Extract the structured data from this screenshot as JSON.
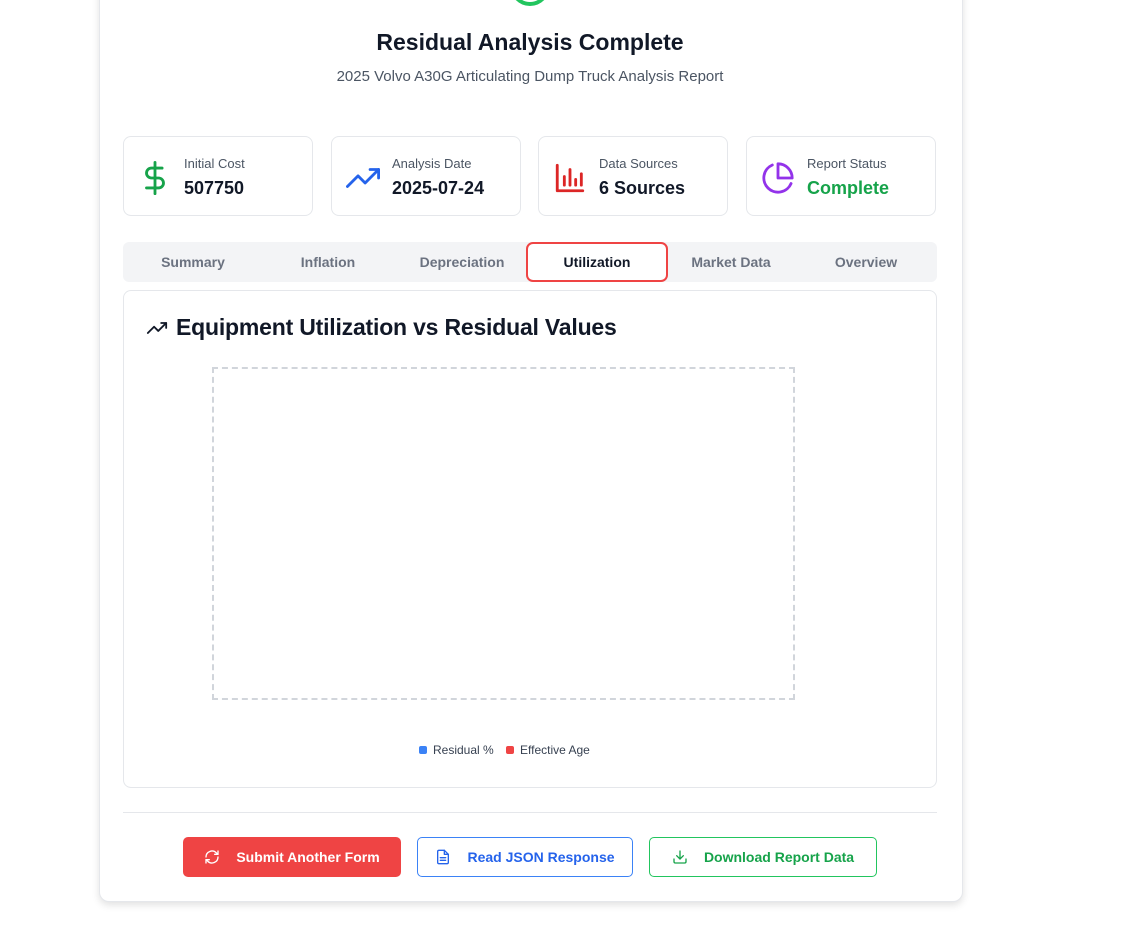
{
  "header": {
    "title": "Residual Analysis Complete",
    "subtitle": "2025 Volvo A30G Articulating Dump Truck Analysis Report"
  },
  "stats": [
    {
      "label": "Initial Cost",
      "value": "507750",
      "icon": "dollar-icon",
      "color": "#16a34a"
    },
    {
      "label": "Analysis Date",
      "value": "2025-07-24",
      "icon": "trending-up-icon",
      "color": "#2563eb"
    },
    {
      "label": "Data Sources",
      "value": "6 Sources",
      "icon": "bar-chart-icon",
      "color": "#dc2626"
    },
    {
      "label": "Report Status",
      "value": "Complete",
      "icon": "pie-chart-icon",
      "color": "#9333ea"
    }
  ],
  "tabs": [
    {
      "label": "Summary",
      "active": false
    },
    {
      "label": "Inflation",
      "active": false
    },
    {
      "label": "Depreciation",
      "active": false
    },
    {
      "label": "Utilization",
      "active": true
    },
    {
      "label": "Market Data",
      "active": false
    },
    {
      "label": "Overview",
      "active": false
    }
  ],
  "panel": {
    "title": "Equipment Utilization vs Residual Values",
    "legend": [
      {
        "label": "Residual %",
        "color": "#3b82f6"
      },
      {
        "label": "Effective Age",
        "color": "#ef4444"
      }
    ]
  },
  "actions": {
    "submit_label": "Submit Another Form",
    "json_label": "Read JSON Response",
    "download_label": "Download Report Data"
  },
  "colors": {
    "accent_red": "#ef4444",
    "accent_blue": "#2563eb",
    "accent_green": "#16a34a"
  }
}
